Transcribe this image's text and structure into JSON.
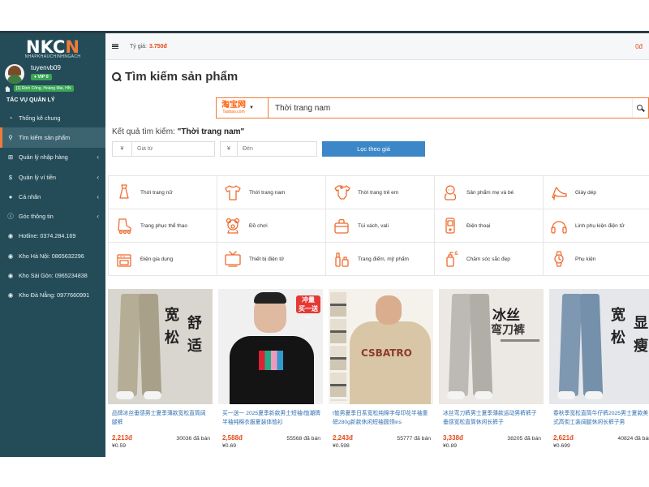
{
  "sidebar": {
    "logo_main_prefix": "NKC",
    "logo_main_accent": "N",
    "logo_sub": "NHAPKHAUCHINHNGACH",
    "username": "tuyenvb09",
    "vip": "VIP 0",
    "address": "[1] Định Công, Hoàng Mai, HN",
    "section_title": "TÁC VỤ QUẢN LÝ",
    "items": [
      {
        "label": "Thống kê chung",
        "icon": "dashboard-icon",
        "glyph": "◔",
        "chevron": false
      },
      {
        "label": "Tìm kiếm sản phẩm",
        "icon": "search-icon",
        "glyph": "⚲",
        "chevron": false
      },
      {
        "label": "Quản lý nhập hàng",
        "icon": "cart-icon",
        "glyph": "⊞",
        "chevron": true
      },
      {
        "label": "Quản lý ví tiền",
        "icon": "dollar-icon",
        "glyph": "$",
        "chevron": true
      },
      {
        "label": "Cá nhân",
        "icon": "user-icon",
        "glyph": "●",
        "chevron": true
      },
      {
        "label": "Góc thông tin",
        "icon": "info-icon",
        "glyph": "ⓘ",
        "chevron": true
      },
      {
        "label": "Hotline: 0374.284.169",
        "icon": "globe-icon",
        "glyph": "◉",
        "chevron": false
      },
      {
        "label": "Kho Hà Nội: 0865632296",
        "icon": "globe-icon",
        "glyph": "◉",
        "chevron": false
      },
      {
        "label": "Kho Sài Gòn: 0965234838",
        "icon": "globe-icon",
        "glyph": "◉",
        "chevron": false
      },
      {
        "label": "Kho Đà Nẵng: 0977660991",
        "icon": "globe-icon",
        "glyph": "◉",
        "chevron": false
      }
    ]
  },
  "topbar": {
    "rate_label": "Tỷ giá:",
    "rate_value": "3.750đ",
    "balance": "0đ"
  },
  "search": {
    "page_title": "Tìm kiếm sản phẩm",
    "source_main": "淘宝网",
    "source_sub": "Taobao.com",
    "query": "Thời trang nam",
    "result_prefix": "Kết quả tìm kiếm: ",
    "result_query": "\"Thời trang nam\"",
    "price_from_placeholder": "Giá từ",
    "price_to_placeholder": "Đến",
    "currency_symbol": "¥",
    "filter_button": "Lọc theo giá"
  },
  "categories": [
    {
      "label": "Thời trang nữ",
      "icon": "dress-icon"
    },
    {
      "label": "Thời trang nam",
      "icon": "tshirt-icon"
    },
    {
      "label": "Thời trang trẻ em",
      "icon": "baby-onesie-icon"
    },
    {
      "label": "Sản phẩm mẹ và bé",
      "icon": "baby-icon"
    },
    {
      "label": "Giày dép",
      "icon": "high-heel-icon"
    },
    {
      "label": "Trang phục thể thao",
      "icon": "skate-icon"
    },
    {
      "label": "Đồ chơi",
      "icon": "teddy-bear-icon"
    },
    {
      "label": "Túi xách, vali",
      "icon": "bag-icon"
    },
    {
      "label": "Điện thoại",
      "icon": "phone-icon"
    },
    {
      "label": "Linh phụ kiện điện tử",
      "icon": "headphones-icon"
    },
    {
      "label": "Điện gia dụng",
      "icon": "stove-icon"
    },
    {
      "label": "Thiết bị điện tử",
      "icon": "tv-icon"
    },
    {
      "label": "Trang điểm, mỹ phẩm",
      "icon": "cosmetics-icon"
    },
    {
      "label": "Chăm sóc sắc đẹp",
      "icon": "spray-icon"
    },
    {
      "label": "Phụ kiện",
      "icon": "watch-icon"
    }
  ],
  "products": [
    {
      "name": "品牌冰丝垂感男士夏季薄款宽松直筒阔腿裤",
      "price": "2,213đ",
      "sold": "30036 đã bán",
      "yuan": "¥0.59",
      "overlay": "宽 舒 松 适"
    },
    {
      "name": "买一送一 2025夏季新款男士短袖t恤潮牌半袖纯棉衣服夏装体恤衫",
      "price": "2,588đ",
      "sold": "55568 đã bán",
      "yuan": "¥0.69",
      "overlay": "冲量 买一送一"
    },
    {
      "name": "t恤男夏季日系宽松纯棉字母印花半袖重磅280g新款休闲短袖圆领ins",
      "price": "2,243đ",
      "sold": "55777 đã bán",
      "yuan": "¥0.598",
      "overlay": "CSBATRO"
    },
    {
      "name": "冰丝弯刀裤男士夏季薄款运动男裤裤子垂感宽松直筒休闲长裤子",
      "price": "3,338đ",
      "sold": "38205 đã bán",
      "yuan": "¥0.89",
      "overlay": "冰丝 弯刀裤"
    },
    {
      "name": "春秋季宽松直筒牛仔裤2025男士夏款美式高街工装阔腿休闲长裤子男",
      "price": "2,621đ",
      "sold": "40824 đã bán",
      "yuan": "¥0.699",
      "overlay": "宽 显 松 瘦"
    }
  ],
  "colors": {
    "sidebar_bg": "#244c58",
    "accent": "#f07b3a",
    "price": "#e64a19",
    "link": "#2f6fb0",
    "filter_button": "#3b87c7"
  }
}
